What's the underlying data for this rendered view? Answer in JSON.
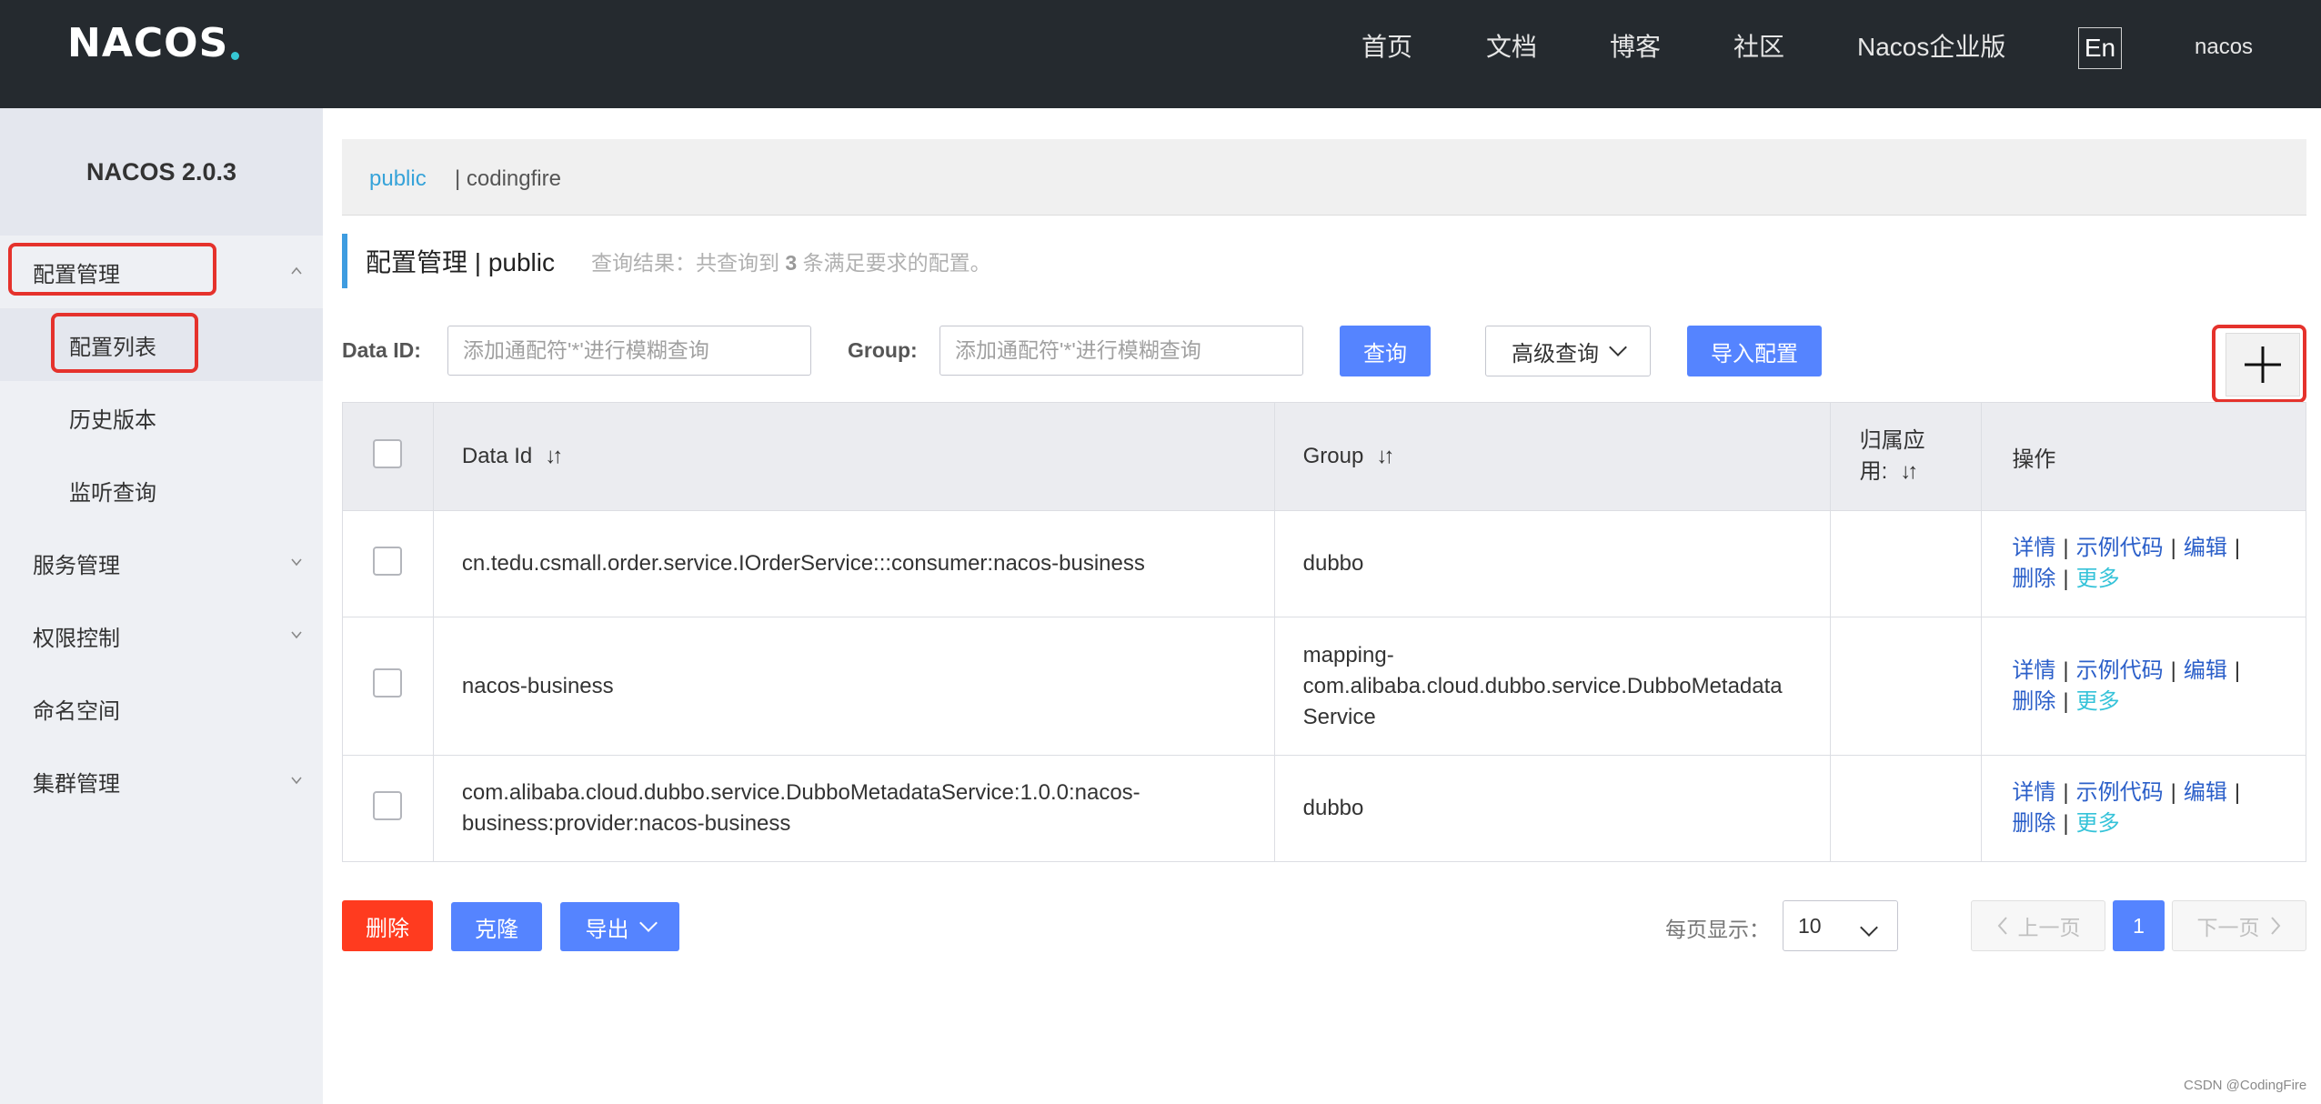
{
  "header": {
    "logo": "NACOS",
    "nav": [
      "首页",
      "文档",
      "博客",
      "社区",
      "Nacos企业版"
    ],
    "lang": "En",
    "user": "nacos"
  },
  "sidebar": {
    "title": "NACOS 2.0.3",
    "items": [
      {
        "label": "配置管理"
      },
      {
        "label": "配置列表"
      },
      {
        "label": "历史版本"
      },
      {
        "label": "监听查询"
      },
      {
        "label": "服务管理"
      },
      {
        "label": "权限控制"
      },
      {
        "label": "命名空间"
      },
      {
        "label": "集群管理"
      }
    ]
  },
  "namespace": {
    "active": "public",
    "other": "| codingfire"
  },
  "heading": {
    "title": "配置管理 | public",
    "result_prefix": "查询结果：共查询到",
    "result_count": "3",
    "result_suffix": "条满足要求的配置。"
  },
  "filters": {
    "dataid_label": "Data ID:",
    "dataid_placeholder": "添加通配符'*'进行模糊查询",
    "group_label": "Group:",
    "group_placeholder": "添加通配符'*'进行模糊查询",
    "search_button": "查询",
    "advanced_button": "高级查询",
    "import_button": "导入配置",
    "add_symbol": "+"
  },
  "table": {
    "headers": {
      "dataid": "Data Id",
      "group": "Group",
      "app_line1": "归属应",
      "app_line2": "用:",
      "ops": "操作",
      "sort": "↓↑"
    },
    "ops_labels": {
      "detail": "详情",
      "sample": "示例代码",
      "edit": "编辑",
      "delete": "删除",
      "more": "更多",
      "sep": "|"
    },
    "rows": [
      {
        "dataid_lines": [
          "cn.tedu.csmall.order.service.IOrderService:::consumer:nacos-business"
        ],
        "group_lines": [
          "dubbo"
        ],
        "app": ""
      },
      {
        "dataid_lines": [
          "nacos-business"
        ],
        "group_lines": [
          "mapping-",
          "com.alibaba.cloud.dubbo.service.DubboMetadata",
          "Service"
        ],
        "app": ""
      },
      {
        "dataid_lines": [
          "com.alibaba.cloud.dubbo.service.DubboMetadataService:1.0.0:nacos-",
          "business:provider:nacos-business"
        ],
        "group_lines": [
          "dubbo"
        ],
        "app": ""
      }
    ]
  },
  "footer": {
    "delete_button": "删除",
    "clone_button": "克隆",
    "export_button": "导出",
    "page_size_label": "每页显示：",
    "page_size": "10",
    "prev": "上一页",
    "current_page": "1",
    "next": "下一页"
  },
  "watermark": "CSDN @CodingFire",
  "colors": {
    "header_bg": "#252a2f",
    "sidebar_bg": "#eef0f4",
    "primary": "#5584ff",
    "danger": "#ff3b1f",
    "link": "#2b5fc9",
    "highlight": "#e5322c"
  }
}
